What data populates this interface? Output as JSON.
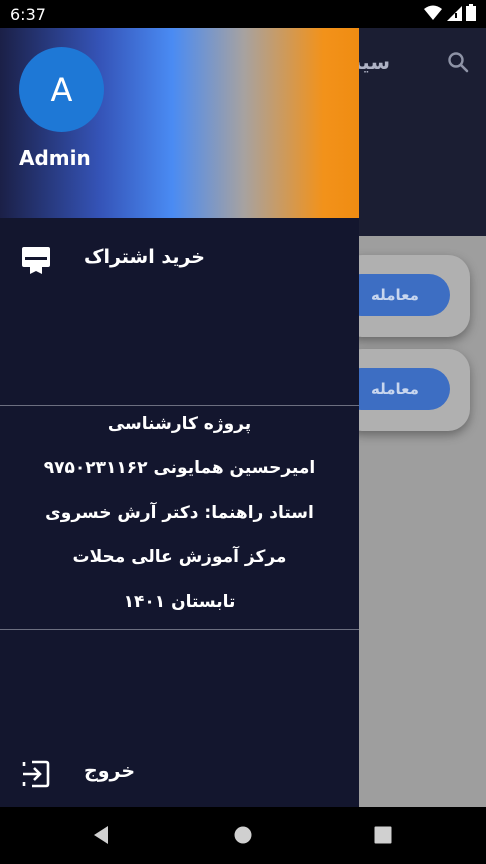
{
  "status_bar": {
    "time": "6:37"
  },
  "app": {
    "title_partial": "سیب",
    "deal_buttons": [
      "معامله",
      "معامله"
    ]
  },
  "drawer": {
    "avatar_letter": "A",
    "user_name": "Admin",
    "menu": {
      "subscribe_label": "خرید اشتراک",
      "logout_label": "خروج"
    },
    "info": {
      "lines": [
        "پروژه کارشناسی",
        "امیرحسین همایونی ۹۷۵۰۲۳۱۱۶۲",
        "استاد راهنما: دکتر آرش خسروی",
        "مرکز آموزش عالی محلات",
        "تابستان ۱۴۰۱"
      ]
    }
  },
  "colors": {
    "drawer_bg": "#13162e",
    "avatar": "#1e78d6",
    "accent_button": "#3d6ec3",
    "gradient": [
      "#1b2047",
      "#4a8bf3",
      "#f08c12"
    ]
  },
  "icons": {
    "subscribe": "card-membership-icon",
    "logout": "exit-to-app-icon",
    "search": "search-icon"
  }
}
